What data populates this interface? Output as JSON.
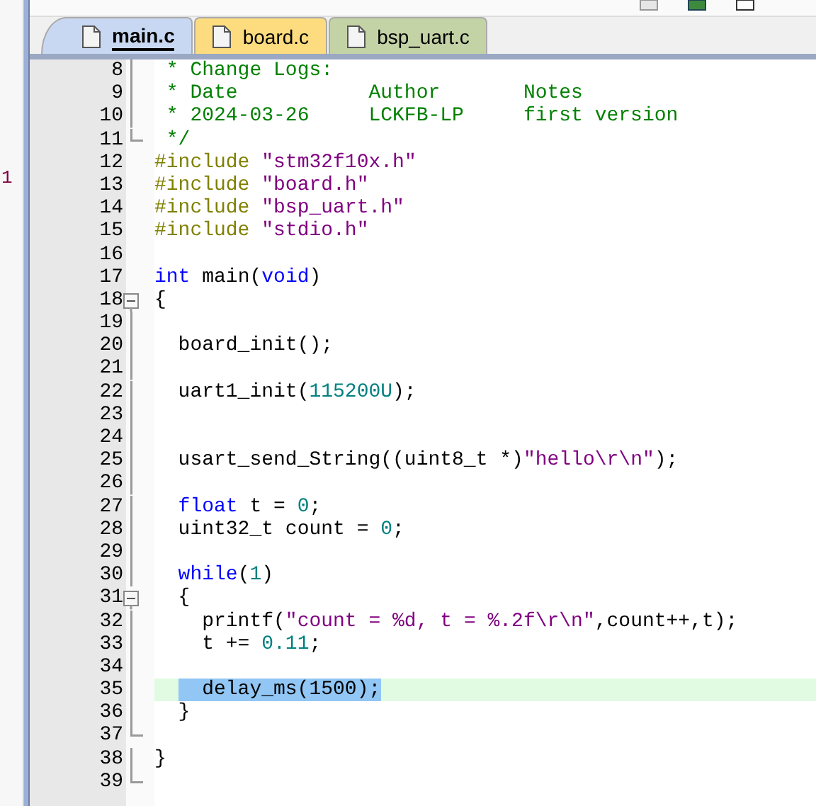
{
  "side_panel": {
    "text": "1"
  },
  "tabs": [
    {
      "label": "main.c",
      "selected": true,
      "color": "#c9d8f2"
    },
    {
      "label": "board.c",
      "selected": false,
      "color": "#fddc7f"
    },
    {
      "label": "bsp_uart.c",
      "selected": false,
      "color": "#c4d3a6"
    }
  ],
  "lines": [
    {
      "number": "8",
      "kind": "foldline",
      "current": false,
      "segments": [
        {
          "text": " * Change Logs:",
          "kind": "comment"
        }
      ]
    },
    {
      "number": "9",
      "kind": "foldline",
      "current": false,
      "segments": [
        {
          "text": " * Date           Author       Notes",
          "kind": "comment"
        }
      ]
    },
    {
      "number": "10",
      "kind": "foldline",
      "current": false,
      "segments": [
        {
          "text": " * 2024-03-26     LCKFB-LP     first version",
          "kind": "comment"
        }
      ]
    },
    {
      "number": "11",
      "kind": "foldend",
      "current": false,
      "segments": [
        {
          "text": " */",
          "kind": "comment"
        }
      ]
    },
    {
      "number": "12",
      "kind": "plain",
      "current": false,
      "segments": [
        {
          "text": "#include ",
          "kind": "preproc"
        },
        {
          "text": "\"stm32f10x.h\"",
          "kind": "string"
        }
      ]
    },
    {
      "number": "13",
      "kind": "plain",
      "current": false,
      "segments": [
        {
          "text": "#include ",
          "kind": "preproc"
        },
        {
          "text": "\"board.h\"",
          "kind": "string"
        }
      ]
    },
    {
      "number": "14",
      "kind": "plain",
      "current": false,
      "segments": [
        {
          "text": "#include ",
          "kind": "preproc"
        },
        {
          "text": "\"bsp_uart.h\"",
          "kind": "string"
        }
      ]
    },
    {
      "number": "15",
      "kind": "plain",
      "current": false,
      "segments": [
        {
          "text": "#include ",
          "kind": "preproc"
        },
        {
          "text": "\"stdio.h\"",
          "kind": "string"
        }
      ]
    },
    {
      "number": "16",
      "kind": "plain"
    },
    {
      "number": "17",
      "kind": "plain",
      "current": false,
      "segments": [
        {
          "text": "int",
          "kind": "keyword"
        },
        {
          "text": " main(",
          "kind": "plain"
        },
        {
          "text": "void",
          "kind": "keyword"
        },
        {
          "text": ")",
          "kind": "plain"
        }
      ]
    },
    {
      "number": "18",
      "kind": "foldstart",
      "current": false,
      "segments": [
        {
          "text": "{",
          "kind": "plain"
        }
      ]
    },
    {
      "number": "19",
      "kind": "foldline"
    },
    {
      "number": "20",
      "kind": "foldline",
      "current": false,
      "segments": [
        {
          "text": "  board_init();",
          "kind": "plain"
        }
      ]
    },
    {
      "number": "21",
      "kind": "foldline"
    },
    {
      "number": "22",
      "kind": "foldline",
      "current": false,
      "segments": [
        {
          "text": "  uart1_init(",
          "kind": "plain"
        },
        {
          "text": "115200U",
          "kind": "number"
        },
        {
          "text": ");",
          "kind": "plain"
        }
      ]
    },
    {
      "number": "23",
      "kind": "foldline"
    },
    {
      "number": "24",
      "kind": "foldline"
    },
    {
      "number": "25",
      "kind": "foldline",
      "current": false,
      "segments": [
        {
          "text": "  usart_send_String((uint8_t *)",
          "kind": "plain"
        },
        {
          "text": "\"hello\\r\\n\"",
          "kind": "string"
        },
        {
          "text": ");",
          "kind": "plain"
        }
      ]
    },
    {
      "number": "26",
      "kind": "foldline"
    },
    {
      "number": "27",
      "kind": "foldline",
      "current": false,
      "segments": [
        {
          "text": "  float",
          "kind": "keyword"
        },
        {
          "text": " t = ",
          "kind": "plain"
        },
        {
          "text": "0",
          "kind": "number"
        },
        {
          "text": ";",
          "kind": "plain"
        }
      ]
    },
    {
      "number": "28",
      "kind": "foldline",
      "current": false,
      "segments": [
        {
          "text": "  uint32_t count = ",
          "kind": "plain"
        },
        {
          "text": "0",
          "kind": "number"
        },
        {
          "text": ";",
          "kind": "plain"
        }
      ]
    },
    {
      "number": "29",
      "kind": "foldline"
    },
    {
      "number": "30",
      "kind": "foldline",
      "current": false,
      "segments": [
        {
          "text": "  while",
          "kind": "keyword"
        },
        {
          "text": "(",
          "kind": "plain"
        },
        {
          "text": "1",
          "kind": "number"
        },
        {
          "text": ")",
          "kind": "plain"
        }
      ]
    },
    {
      "number": "31",
      "kind": "foldstart",
      "current": false,
      "segments": [
        {
          "text": "  {",
          "kind": "plain"
        }
      ]
    },
    {
      "number": "32",
      "kind": "foldline",
      "current": false,
      "segments": [
        {
          "text": "    printf(",
          "kind": "plain"
        },
        {
          "text": "\"count = %d, t = %.2f\\r\\n\"",
          "kind": "string"
        },
        {
          "text": ",count++,t);",
          "kind": "plain"
        }
      ]
    },
    {
      "number": "33",
      "kind": "foldline",
      "current": false,
      "segments": [
        {
          "text": "    t += ",
          "kind": "plain"
        },
        {
          "text": "0.11",
          "kind": "number"
        },
        {
          "text": ";",
          "kind": "plain"
        }
      ]
    },
    {
      "number": "34",
      "kind": "foldline"
    },
    {
      "number": "35",
      "kind": "foldline",
      "current": true,
      "segments": [
        {
          "text": "  delay_ms(1500);",
          "kind": "selected"
        }
      ]
    },
    {
      "number": "36",
      "kind": "foldline",
      "current": false,
      "segments": [
        {
          "text": "  }",
          "kind": "plain"
        }
      ]
    },
    {
      "number": "37",
      "kind": "foldend"
    },
    {
      "number": "38",
      "kind": "foldline",
      "current": false,
      "segments": [
        {
          "text": "}",
          "kind": "plain"
        }
      ]
    },
    {
      "number": "39",
      "kind": "foldend"
    }
  ]
}
